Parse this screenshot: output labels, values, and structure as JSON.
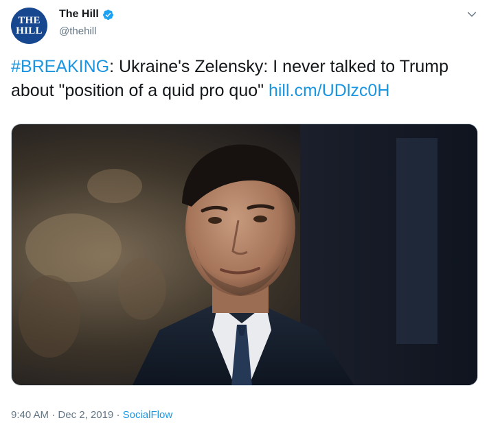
{
  "account": {
    "avatar_line1": "THE",
    "avatar_line2": "HILL",
    "display_name": "The Hill",
    "handle": "@thehill",
    "verified_icon": "verified-badge-icon"
  },
  "tweet": {
    "hashtag": "#BREAKING",
    "text": ": Ukraine's Zelensky: I never talked to Trump about \"position of a quid pro quo\" ",
    "link": "hill.cm/UDlzc0H"
  },
  "media": {
    "type": "photo"
  },
  "meta": {
    "time": "9:40 AM",
    "separator1": " · ",
    "date": "Dec 2, 2019",
    "separator2": " · ",
    "source": "SocialFlow"
  },
  "colors": {
    "link": "#1b95e0",
    "secondary_text": "#657786",
    "avatar_bg": "#16478f"
  }
}
